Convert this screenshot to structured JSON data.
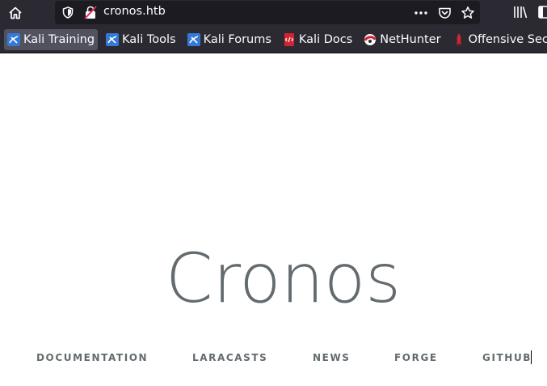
{
  "browser": {
    "url": "cronos.htb",
    "colors": {
      "toolbar": "#2b2a33",
      "urlbar": "#1c1b22",
      "text": "#fbfbfe",
      "active_bookmark": "#52525e"
    }
  },
  "bookmarks": [
    {
      "label": "Kali Training",
      "icon": "kali-dragon-icon",
      "active": true
    },
    {
      "label": "Kali Tools",
      "icon": "kali-dragon-icon"
    },
    {
      "label": "Kali Forums",
      "icon": "kali-dragon-icon"
    },
    {
      "label": "Kali Docs",
      "icon": "kali-docs-icon"
    },
    {
      "label": "NetHunter",
      "icon": "nethunter-icon"
    },
    {
      "label": "Offensive Security",
      "icon": "offsec-icon"
    }
  ],
  "page": {
    "title": "Cronos",
    "title_color": "#636b6f",
    "links": [
      "DOCUMENTATION",
      "LARACASTS",
      "NEWS",
      "FORGE",
      "GITHUB"
    ]
  }
}
